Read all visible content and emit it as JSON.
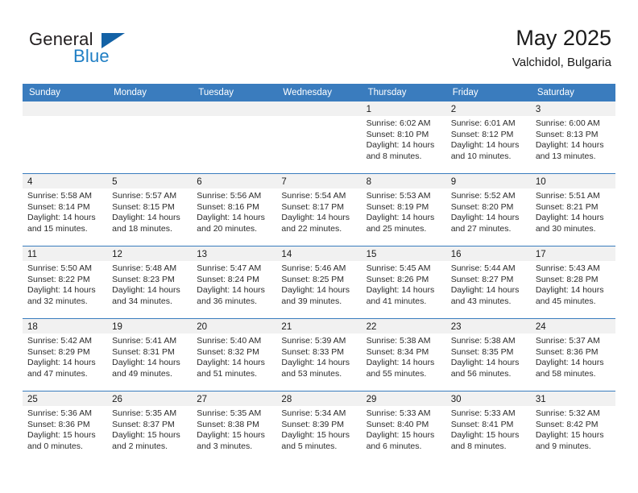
{
  "brand": {
    "name_primary": "General",
    "name_secondary": "Blue",
    "triangle_icon": "triangle-logo-icon",
    "primary_color": "#231f20",
    "secondary_color": "#1f7ec4",
    "triangle_color": "#1362a6"
  },
  "header": {
    "title": "May 2025",
    "location": "Valchidol, Bulgaria"
  },
  "calendar": {
    "header_color": "#3a7cbe",
    "daynum_band_color": "#f1f1f1",
    "weekday_headers": [
      "Sunday",
      "Monday",
      "Tuesday",
      "Wednesday",
      "Thursday",
      "Friday",
      "Saturday"
    ],
    "weeks": [
      [
        {
          "day": "",
          "empty": true,
          "lines": []
        },
        {
          "day": "",
          "empty": true,
          "lines": []
        },
        {
          "day": "",
          "empty": true,
          "lines": []
        },
        {
          "day": "",
          "empty": true,
          "lines": []
        },
        {
          "day": "1",
          "empty": false,
          "lines": [
            "Sunrise: 6:02 AM",
            "Sunset: 8:10 PM",
            "Daylight: 14 hours",
            "and 8 minutes."
          ]
        },
        {
          "day": "2",
          "empty": false,
          "lines": [
            "Sunrise: 6:01 AM",
            "Sunset: 8:12 PM",
            "Daylight: 14 hours",
            "and 10 minutes."
          ]
        },
        {
          "day": "3",
          "empty": false,
          "lines": [
            "Sunrise: 6:00 AM",
            "Sunset: 8:13 PM",
            "Daylight: 14 hours",
            "and 13 minutes."
          ]
        }
      ],
      [
        {
          "day": "4",
          "empty": false,
          "lines": [
            "Sunrise: 5:58 AM",
            "Sunset: 8:14 PM",
            "Daylight: 14 hours",
            "and 15 minutes."
          ]
        },
        {
          "day": "5",
          "empty": false,
          "lines": [
            "Sunrise: 5:57 AM",
            "Sunset: 8:15 PM",
            "Daylight: 14 hours",
            "and 18 minutes."
          ]
        },
        {
          "day": "6",
          "empty": false,
          "lines": [
            "Sunrise: 5:56 AM",
            "Sunset: 8:16 PM",
            "Daylight: 14 hours",
            "and 20 minutes."
          ]
        },
        {
          "day": "7",
          "empty": false,
          "lines": [
            "Sunrise: 5:54 AM",
            "Sunset: 8:17 PM",
            "Daylight: 14 hours",
            "and 22 minutes."
          ]
        },
        {
          "day": "8",
          "empty": false,
          "lines": [
            "Sunrise: 5:53 AM",
            "Sunset: 8:19 PM",
            "Daylight: 14 hours",
            "and 25 minutes."
          ]
        },
        {
          "day": "9",
          "empty": false,
          "lines": [
            "Sunrise: 5:52 AM",
            "Sunset: 8:20 PM",
            "Daylight: 14 hours",
            "and 27 minutes."
          ]
        },
        {
          "day": "10",
          "empty": false,
          "lines": [
            "Sunrise: 5:51 AM",
            "Sunset: 8:21 PM",
            "Daylight: 14 hours",
            "and 30 minutes."
          ]
        }
      ],
      [
        {
          "day": "11",
          "empty": false,
          "lines": [
            "Sunrise: 5:50 AM",
            "Sunset: 8:22 PM",
            "Daylight: 14 hours",
            "and 32 minutes."
          ]
        },
        {
          "day": "12",
          "empty": false,
          "lines": [
            "Sunrise: 5:48 AM",
            "Sunset: 8:23 PM",
            "Daylight: 14 hours",
            "and 34 minutes."
          ]
        },
        {
          "day": "13",
          "empty": false,
          "lines": [
            "Sunrise: 5:47 AM",
            "Sunset: 8:24 PM",
            "Daylight: 14 hours",
            "and 36 minutes."
          ]
        },
        {
          "day": "14",
          "empty": false,
          "lines": [
            "Sunrise: 5:46 AM",
            "Sunset: 8:25 PM",
            "Daylight: 14 hours",
            "and 39 minutes."
          ]
        },
        {
          "day": "15",
          "empty": false,
          "lines": [
            "Sunrise: 5:45 AM",
            "Sunset: 8:26 PM",
            "Daylight: 14 hours",
            "and 41 minutes."
          ]
        },
        {
          "day": "16",
          "empty": false,
          "lines": [
            "Sunrise: 5:44 AM",
            "Sunset: 8:27 PM",
            "Daylight: 14 hours",
            "and 43 minutes."
          ]
        },
        {
          "day": "17",
          "empty": false,
          "lines": [
            "Sunrise: 5:43 AM",
            "Sunset: 8:28 PM",
            "Daylight: 14 hours",
            "and 45 minutes."
          ]
        }
      ],
      [
        {
          "day": "18",
          "empty": false,
          "lines": [
            "Sunrise: 5:42 AM",
            "Sunset: 8:29 PM",
            "Daylight: 14 hours",
            "and 47 minutes."
          ]
        },
        {
          "day": "19",
          "empty": false,
          "lines": [
            "Sunrise: 5:41 AM",
            "Sunset: 8:31 PM",
            "Daylight: 14 hours",
            "and 49 minutes."
          ]
        },
        {
          "day": "20",
          "empty": false,
          "lines": [
            "Sunrise: 5:40 AM",
            "Sunset: 8:32 PM",
            "Daylight: 14 hours",
            "and 51 minutes."
          ]
        },
        {
          "day": "21",
          "empty": false,
          "lines": [
            "Sunrise: 5:39 AM",
            "Sunset: 8:33 PM",
            "Daylight: 14 hours",
            "and 53 minutes."
          ]
        },
        {
          "day": "22",
          "empty": false,
          "lines": [
            "Sunrise: 5:38 AM",
            "Sunset: 8:34 PM",
            "Daylight: 14 hours",
            "and 55 minutes."
          ]
        },
        {
          "day": "23",
          "empty": false,
          "lines": [
            "Sunrise: 5:38 AM",
            "Sunset: 8:35 PM",
            "Daylight: 14 hours",
            "and 56 minutes."
          ]
        },
        {
          "day": "24",
          "empty": false,
          "lines": [
            "Sunrise: 5:37 AM",
            "Sunset: 8:36 PM",
            "Daylight: 14 hours",
            "and 58 minutes."
          ]
        }
      ],
      [
        {
          "day": "25",
          "empty": false,
          "lines": [
            "Sunrise: 5:36 AM",
            "Sunset: 8:36 PM",
            "Daylight: 15 hours",
            "and 0 minutes."
          ]
        },
        {
          "day": "26",
          "empty": false,
          "lines": [
            "Sunrise: 5:35 AM",
            "Sunset: 8:37 PM",
            "Daylight: 15 hours",
            "and 2 minutes."
          ]
        },
        {
          "day": "27",
          "empty": false,
          "lines": [
            "Sunrise: 5:35 AM",
            "Sunset: 8:38 PM",
            "Daylight: 15 hours",
            "and 3 minutes."
          ]
        },
        {
          "day": "28",
          "empty": false,
          "lines": [
            "Sunrise: 5:34 AM",
            "Sunset: 8:39 PM",
            "Daylight: 15 hours",
            "and 5 minutes."
          ]
        },
        {
          "day": "29",
          "empty": false,
          "lines": [
            "Sunrise: 5:33 AM",
            "Sunset: 8:40 PM",
            "Daylight: 15 hours",
            "and 6 minutes."
          ]
        },
        {
          "day": "30",
          "empty": false,
          "lines": [
            "Sunrise: 5:33 AM",
            "Sunset: 8:41 PM",
            "Daylight: 15 hours",
            "and 8 minutes."
          ]
        },
        {
          "day": "31",
          "empty": false,
          "lines": [
            "Sunrise: 5:32 AM",
            "Sunset: 8:42 PM",
            "Daylight: 15 hours",
            "and 9 minutes."
          ]
        }
      ]
    ]
  }
}
